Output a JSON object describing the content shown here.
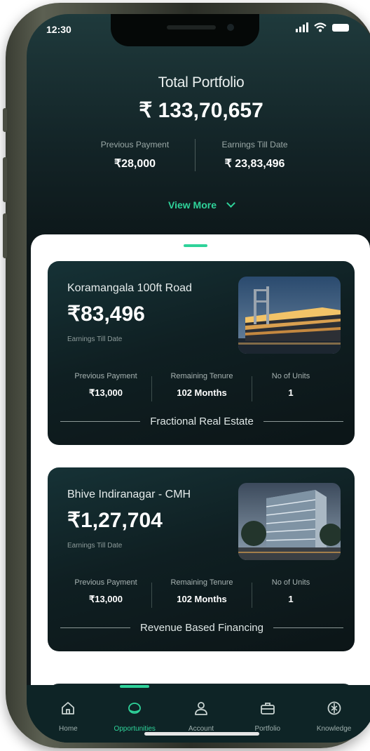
{
  "status_bar": {
    "time": "12:30"
  },
  "portfolio": {
    "title": "Total Portfolio",
    "total": "₹ 133,70,657",
    "previous_payment_label": "Previous Payment",
    "previous_payment_value": "₹28,000",
    "earnings_label": "Earnings Till Date",
    "earnings_value": "₹ 23,83,496",
    "view_more": "View More"
  },
  "cards": [
    {
      "title": "Koramangala 100ft Road",
      "amount": "₹83,496",
      "amount_label": "Earnings Till Date",
      "stats": [
        {
          "label": "Previous Payment",
          "value": "₹13,000"
        },
        {
          "label": "Remaining Tenure",
          "value": "102 Months"
        },
        {
          "label": "No of Units",
          "value": "1"
        }
      ],
      "category": "Fractional Real Estate"
    },
    {
      "title": "Bhive Indiranagar - CMH",
      "amount": "₹1,27,704",
      "amount_label": "Earnings Till Date",
      "stats": [
        {
          "label": "Previous Payment",
          "value": "₹13,000"
        },
        {
          "label": "Remaining Tenure",
          "value": "102 Months"
        },
        {
          "label": "No of Units",
          "value": "1"
        }
      ],
      "category": "Revenue Based Financing"
    }
  ],
  "tabs": [
    {
      "label": "Home",
      "icon": "home-icon"
    },
    {
      "label": "Opportunities",
      "icon": "opportunities-icon",
      "active": true
    },
    {
      "label": "Account",
      "icon": "user-icon"
    },
    {
      "label": "Portfolio",
      "icon": "briefcase-icon"
    },
    {
      "label": "Knowledge",
      "icon": "knowledge-icon"
    }
  ],
  "colors": {
    "accent": "#2fd39a",
    "background_dark": "#0e181b",
    "card": "#0f1f22"
  }
}
